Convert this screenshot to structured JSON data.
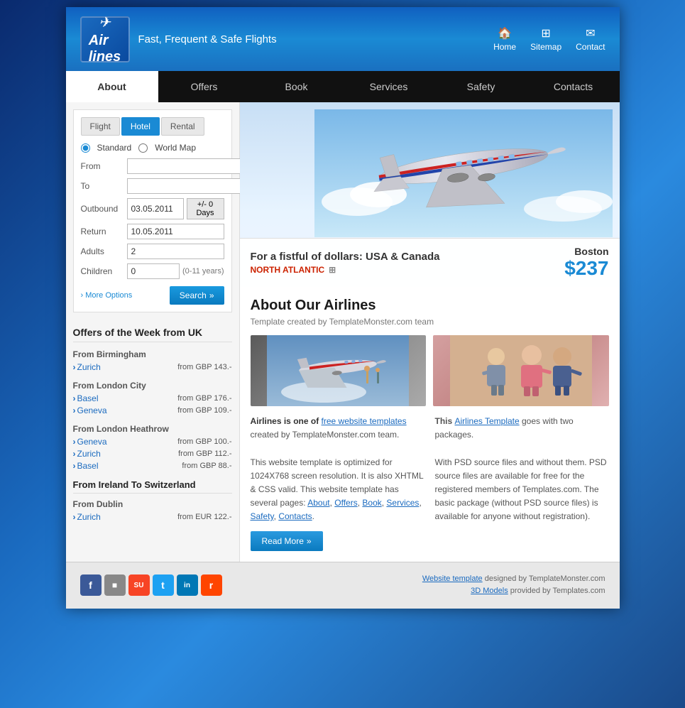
{
  "site": {
    "logo_line1": "Air",
    "logo_line2": "lines",
    "tagline": "Fast, Frequent & Safe Flights",
    "plane_symbol": "✈"
  },
  "header_nav": {
    "items": [
      {
        "label": "Home",
        "icon": "🏠"
      },
      {
        "label": "Sitemap",
        "icon": "🗺"
      },
      {
        "label": "Contact",
        "icon": "✉"
      }
    ]
  },
  "nav": {
    "items": [
      {
        "label": "About",
        "active": true
      },
      {
        "label": "Offers",
        "active": false
      },
      {
        "label": "Book",
        "active": false
      },
      {
        "label": "Services",
        "active": false
      },
      {
        "label": "Safety",
        "active": false
      },
      {
        "label": "Contacts",
        "active": false
      }
    ]
  },
  "search": {
    "tabs": [
      "Flight",
      "Hotel",
      "Rental"
    ],
    "active_tab": "Hotel",
    "radio_standard": "Standard",
    "radio_world_map": "World Map",
    "fields": {
      "from_label": "From",
      "from_value": "",
      "to_label": "To",
      "to_value": "",
      "outbound_label": "Outbound",
      "outbound_value": "03.05.2011",
      "days_btn": "+/- 0 Days",
      "return_label": "Return",
      "return_value": "10.05.2011",
      "adults_label": "Adults",
      "adults_value": "2",
      "children_label": "Children",
      "children_value": "0",
      "children_note": "(0-11 years)"
    },
    "more_options": "More Options",
    "search_btn": "Search"
  },
  "offers": {
    "section_title": "Offers of the Week from UK",
    "groups": [
      {
        "title": "From Birmingham",
        "items": [
          {
            "city": "Zurich",
            "price": "from GBP 143.-"
          }
        ]
      },
      {
        "title": "From London City",
        "items": [
          {
            "city": "Basel",
            "price": "from GBP 176.-"
          },
          {
            "city": "Geneva",
            "price": "from GBP 109.-"
          }
        ]
      },
      {
        "title": "From London Heathrow",
        "items": [
          {
            "city": "Geneva",
            "price": "from GBP 100.-"
          },
          {
            "city": "Zurich",
            "price": "from GBP 112.-"
          },
          {
            "city": "Basel",
            "price": "from GBP 88.-"
          }
        ]
      }
    ],
    "section2_title": "From Ireland To Switzerland",
    "groups2": [
      {
        "title": "From Dublin",
        "items": [
          {
            "city": "Zurich",
            "price": "from EUR 122.-"
          }
        ]
      }
    ]
  },
  "hero": {
    "title": "For a fistful of dollars: USA & Canada",
    "subtitle": "NORTH ATLANTIC",
    "city": "Boston",
    "price": "$237"
  },
  "about": {
    "title": "About Our Airlines",
    "subtitle": "Template created by TemplateMonster.com team",
    "left_text_bold": "Airlines is one of ",
    "left_link": "free website templates",
    "left_text2": " created by TemplateMonster.com team.",
    "left_para": "This website template is optimized for 1024X768 screen resolution. It is also XHTML & CSS valid. This website template has several pages: About, Offers, Book, Services, Safety, Contacts.",
    "right_text_bold": "This ",
    "right_link": "Airlines Template",
    "right_text2": " goes with two packages.",
    "right_para": "With PSD source files and without them. PSD source files are available for free for the registered members of Templates.com. The basic package (without PSD source files) is available for anyone without registration).",
    "read_more": "Read More"
  },
  "footer": {
    "social": [
      {
        "label": "f",
        "color": "#3b5998",
        "name": "facebook"
      },
      {
        "label": "d",
        "color": "#888",
        "name": "delicious"
      },
      {
        "label": "su",
        "color": "#f74425",
        "name": "stumbleupon"
      },
      {
        "label": "t",
        "color": "#1da1f2",
        "name": "twitter"
      },
      {
        "label": "in",
        "color": "#0077b5",
        "name": "linkedin"
      },
      {
        "label": "r",
        "color": "#ff4500",
        "name": "reddit"
      }
    ],
    "copyright1": "Website template designed by TemplateMonster.com",
    "copyright2": "3D Models provided by Templates.com",
    "link1": "Website template",
    "link2": "3D Models"
  }
}
